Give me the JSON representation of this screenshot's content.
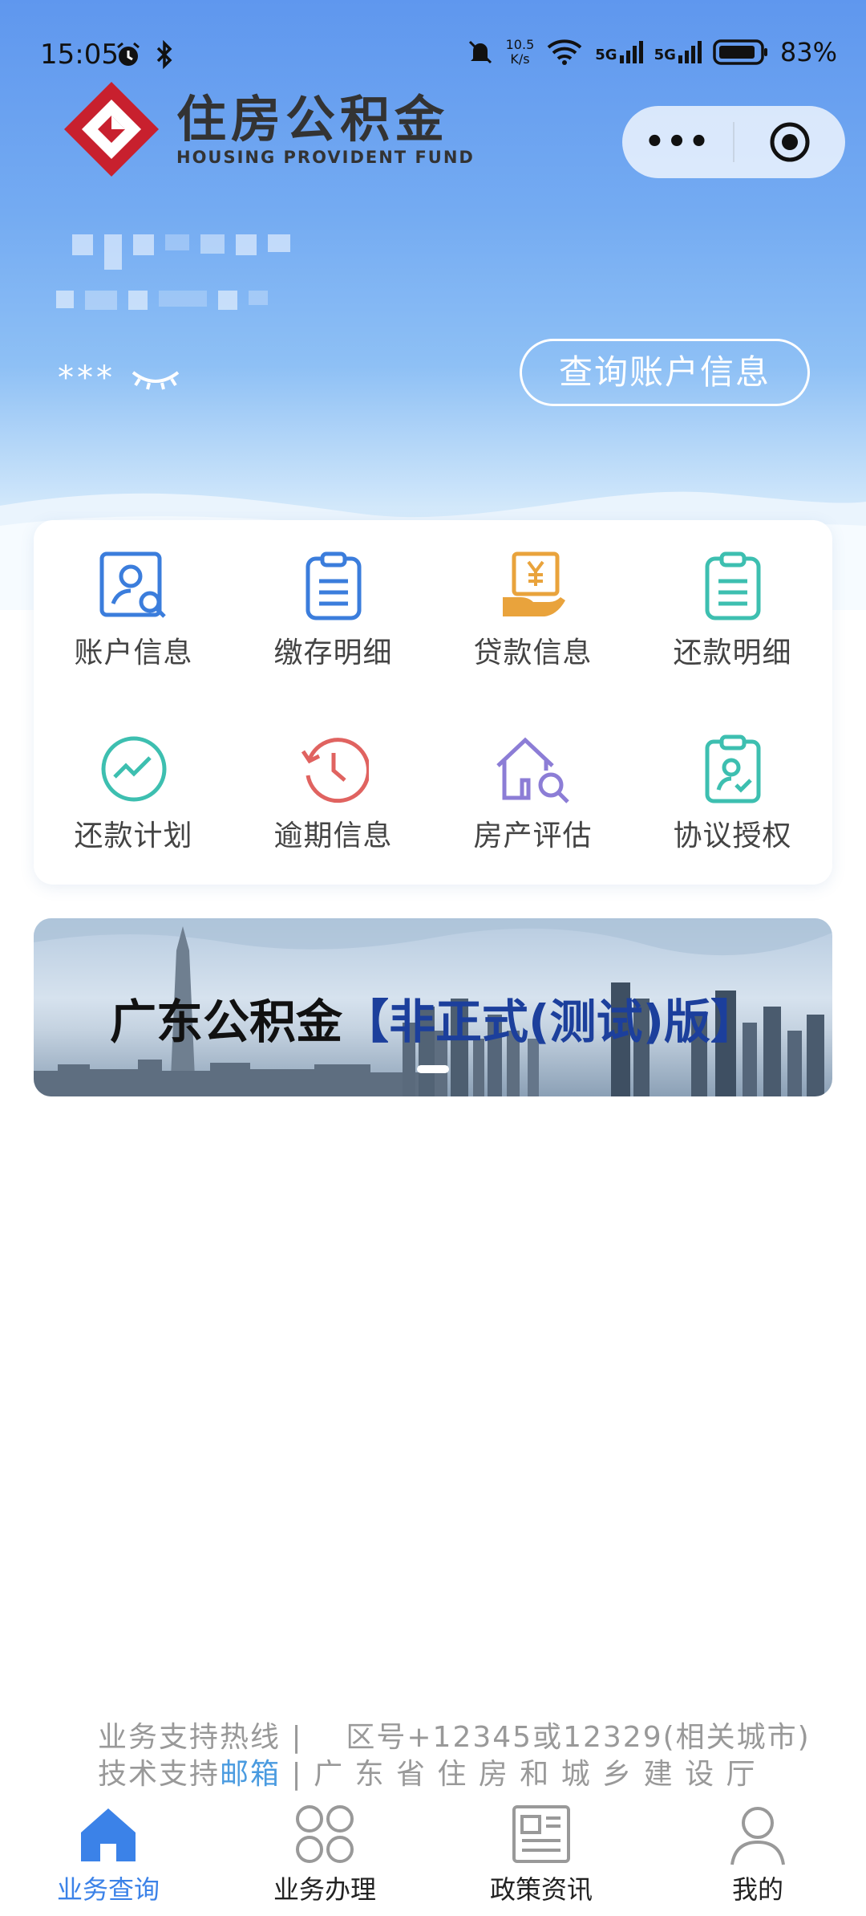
{
  "status_bar": {
    "time": "15:05",
    "net_speed_value": "10.5",
    "net_speed_unit": "K/s",
    "signal_1": "5G",
    "signal_2": "5G",
    "battery": "83%"
  },
  "header": {
    "logo_cn": "住房公积金",
    "logo_en": "HOUSING PROVIDENT FUND"
  },
  "capsule": {
    "more_label": "•••"
  },
  "account": {
    "masked_name": "***",
    "query_button": "查询账户信息"
  },
  "services": [
    {
      "label": "账户信息",
      "icon": "account-search-icon",
      "color": "#3b7ddc"
    },
    {
      "label": "缴存明细",
      "icon": "clipboard-list-icon",
      "color": "#3b7ddc"
    },
    {
      "label": "贷款信息",
      "icon": "loan-yen-icon",
      "color": "#e9a33c"
    },
    {
      "label": "还款明细",
      "icon": "clipboard-list-icon",
      "color": "#3dbfb0"
    },
    {
      "label": "还款计划",
      "icon": "trend-chart-icon",
      "color": "#3dbfb0"
    },
    {
      "label": "逾期信息",
      "icon": "clock-history-icon",
      "color": "#e06360"
    },
    {
      "label": "房产评估",
      "icon": "house-search-icon",
      "color": "#8c7dd6"
    },
    {
      "label": "协议授权",
      "icon": "clipboard-user-icon",
      "color": "#3dbfb0"
    }
  ],
  "banner": {
    "title_main": "广东公积金",
    "title_tag": "【非正式(测试)版】"
  },
  "footer": {
    "hotline_label": "业务支持热线",
    "hotline_value": "区号+12345或12329(相关城市)",
    "tech_label": "技术支持",
    "email_link": "邮箱",
    "department": "广 东 省 住 房 和 城 乡 建 设 厅",
    "separator": "|"
  },
  "tabs": [
    {
      "label": "业务查询",
      "icon": "home-icon",
      "active": true
    },
    {
      "label": "业务办理",
      "icon": "grid-clover-icon",
      "active": false
    },
    {
      "label": "政策资讯",
      "icon": "newspaper-icon",
      "active": false
    },
    {
      "label": "我的",
      "icon": "user-icon",
      "active": false
    }
  ]
}
